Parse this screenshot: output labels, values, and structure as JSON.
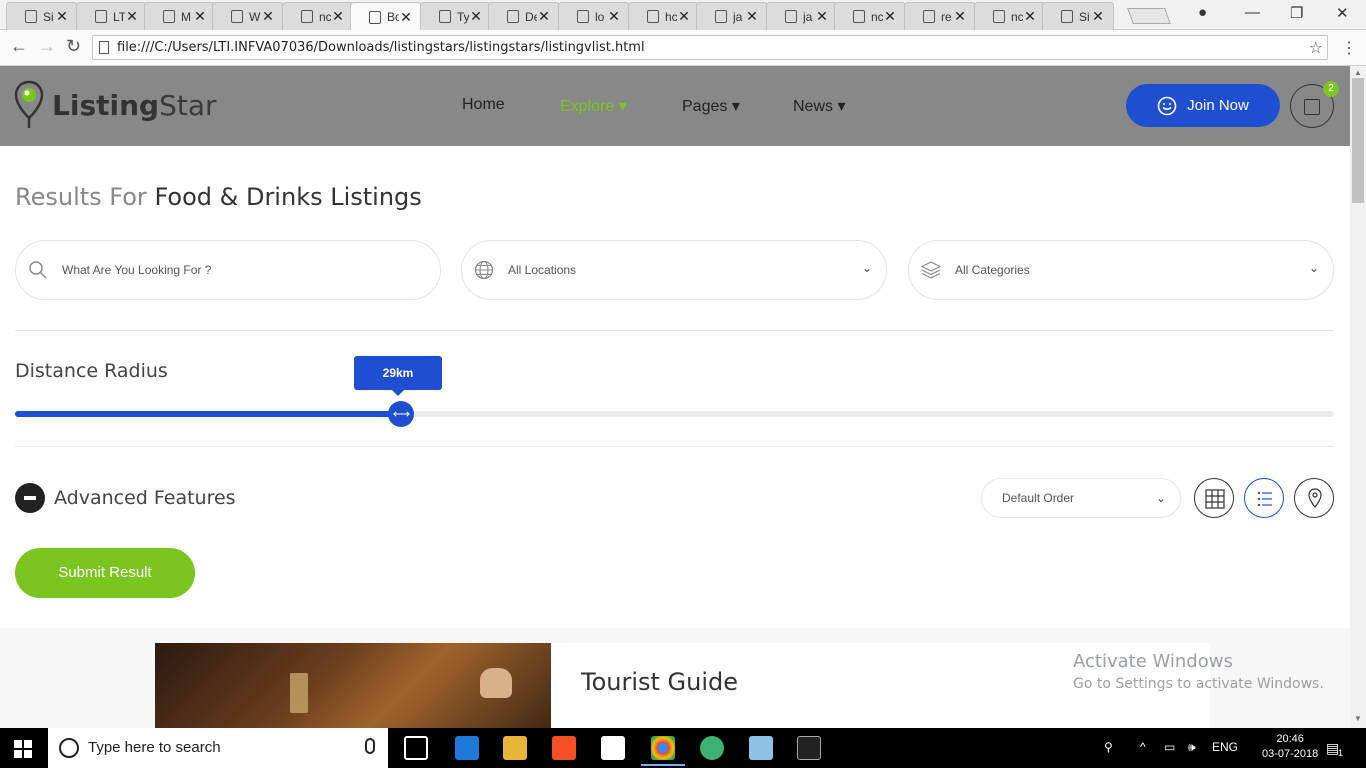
{
  "browser": {
    "tabs": [
      {
        "title": "Si"
      },
      {
        "title": "LT"
      },
      {
        "title": "M"
      },
      {
        "title": "W"
      },
      {
        "title": "nc"
      },
      {
        "title": "Bo"
      },
      {
        "title": "Ty"
      },
      {
        "title": "De"
      },
      {
        "title": "lo"
      },
      {
        "title": "hc"
      },
      {
        "title": "ja"
      },
      {
        "title": "ja"
      },
      {
        "title": "nc"
      },
      {
        "title": "re"
      },
      {
        "title": "nc"
      },
      {
        "title": "Si"
      }
    ],
    "close_glyph": "✕",
    "url": "file:///C:/Users/LTI.INFVA07036/Downloads/listingstars/listingstars/listingvlist.html"
  },
  "site": {
    "logo_bold": "Listing",
    "logo_light": "Star",
    "nav": [
      {
        "label": "Home",
        "caret": ""
      },
      {
        "label": "Explore",
        "caret": "▾"
      },
      {
        "label": "Pages",
        "caret": "▾"
      },
      {
        "label": "News",
        "caret": "▾"
      }
    ],
    "join_label": "Join Now",
    "cart_count": "2",
    "accent": "#1f4fd1",
    "green": "#7cc520"
  },
  "search": {
    "title_prefix": "Results For",
    "title_main": "Food & Drinks Listings",
    "keyword_placeholder": "What Are You Looking For ?",
    "location_value": "All Locations",
    "category_value": "All Categories"
  },
  "filters": {
    "radius_label": "Distance Radius",
    "radius_value": "29km",
    "radius_fraction": 0.293,
    "advanced_label": "Advanced Features",
    "order_value": "Default Order",
    "submit_label": "Submit Result"
  },
  "listing": {
    "title": "Tourist Guide"
  },
  "watermark": {
    "line1": "Activate Windows",
    "line2": "Go to Settings to activate Windows."
  },
  "taskbar": {
    "search_placeholder": "Type here to search",
    "language": "ENG",
    "time": "20:46",
    "date": "03-07-2018",
    "notification_count": "1"
  }
}
